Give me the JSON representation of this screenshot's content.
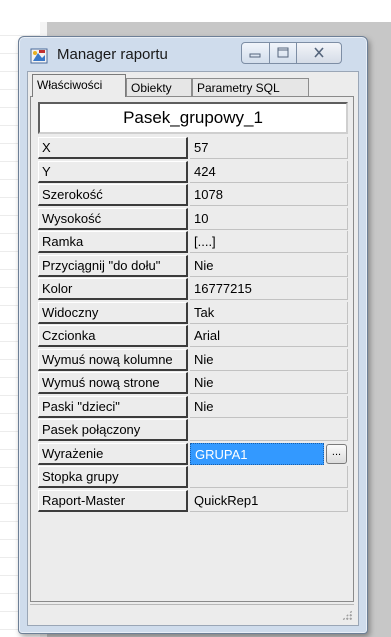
{
  "window": {
    "title": "Manager raportu"
  },
  "tabs": [
    {
      "label": "Właściwości"
    },
    {
      "label": "Obiekty"
    },
    {
      "label": "Parametry SQL"
    }
  ],
  "component_name": "Pasek_grupowy_1",
  "properties": [
    {
      "label": "X",
      "value": "57"
    },
    {
      "label": "Y",
      "value": "424"
    },
    {
      "label": "Szerokość",
      "value": "1078"
    },
    {
      "label": "Wysokość",
      "value": "10"
    },
    {
      "label": "Ramka",
      "value": "[....]"
    },
    {
      "label": "Przyciągnij \"do dołu\"",
      "value": "Nie"
    },
    {
      "label": "Kolor",
      "value": "16777215"
    },
    {
      "label": "Widoczny",
      "value": "Tak"
    },
    {
      "label": "Czcionka",
      "value": "Arial"
    },
    {
      "label": "Wymuś nową kolumne",
      "value": "Nie"
    },
    {
      "label": "Wymuś nową strone",
      "value": "Nie"
    },
    {
      "label": "Paski  \"dzieci\"",
      "value": "Nie"
    },
    {
      "label": "Pasek połączony",
      "value": ""
    },
    {
      "label": "Wyrażenie",
      "value": "GRUPA1"
    },
    {
      "label": "Stopka grupy",
      "value": ""
    },
    {
      "label": "Raport-Master",
      "value": "QuickRep1"
    }
  ],
  "ellipsis_label": "..."
}
